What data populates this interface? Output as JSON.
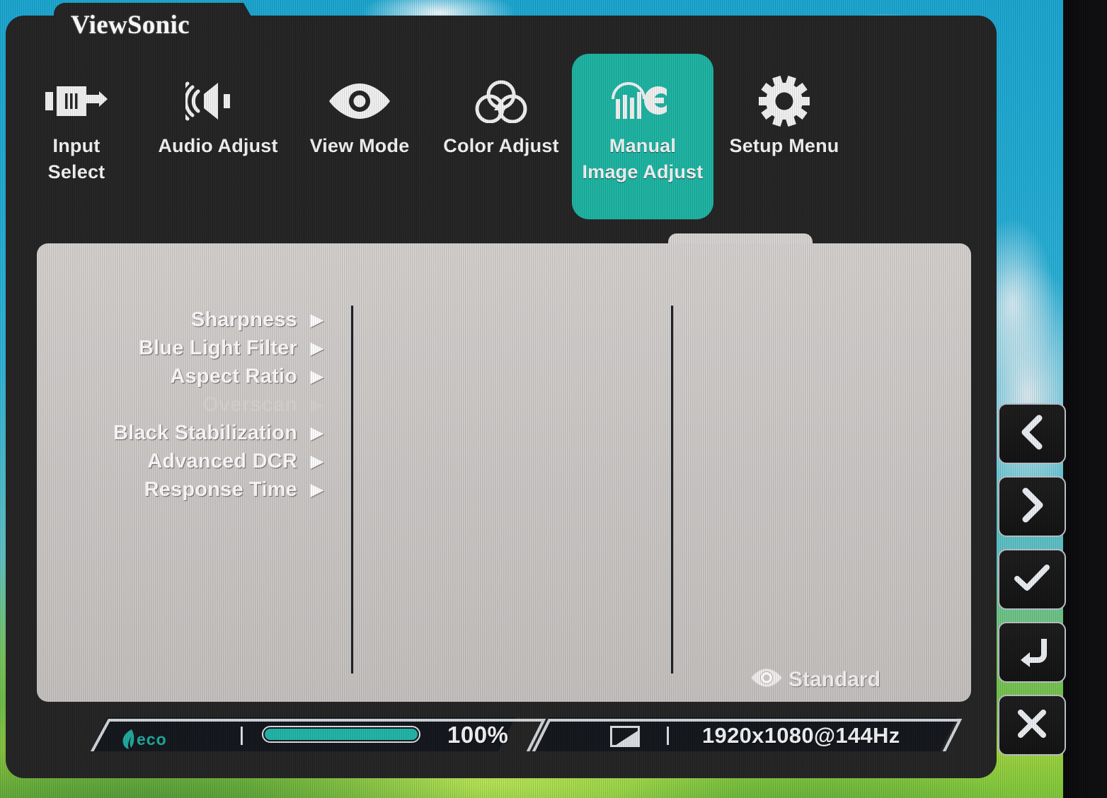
{
  "brand": {
    "logo_text": "ViewSonic"
  },
  "tabs": [
    {
      "id": "input-select",
      "label": "Input\nSelect",
      "icon": "input-connector-icon",
      "selected": false
    },
    {
      "id": "audio-adjust",
      "label": "Audio Adjust",
      "icon": "speaker-icon",
      "selected": false
    },
    {
      "id": "view-mode",
      "label": "View Mode",
      "icon": "eye-icon",
      "selected": false
    },
    {
      "id": "color-adjust",
      "label": "Color Adjust",
      "icon": "color-circles-icon",
      "selected": false
    },
    {
      "id": "manual-image-adjust",
      "label": "Manual\nImage Adjust",
      "icon": "sliders-wrench-icon",
      "selected": true
    },
    {
      "id": "setup-menu",
      "label": "Setup Menu",
      "icon": "gear-icon",
      "selected": false
    }
  ],
  "menu": {
    "items": [
      {
        "label": "Sharpness",
        "arrow": "▶",
        "disabled": false
      },
      {
        "label": "Blue Light Filter",
        "arrow": "▶",
        "disabled": false
      },
      {
        "label": "Aspect Ratio",
        "arrow": "▶",
        "disabled": false
      },
      {
        "label": "Overscan",
        "arrow": "▶",
        "disabled": true
      },
      {
        "label": "Black Stabilization",
        "arrow": "▶",
        "disabled": false
      },
      {
        "label": "Advanced DCR",
        "arrow": "▶",
        "disabled": false
      },
      {
        "label": "Response Time",
        "arrow": "▶",
        "disabled": false
      }
    ]
  },
  "viewmode_badge": {
    "icon": "eye-icon",
    "text": "Standard"
  },
  "statusbar": {
    "eco_label": "eco",
    "eco_icon": "eco-leaf-icon",
    "brightness_percent": "100%",
    "brightness_value": 100,
    "contrast_icon": "contrast-square-icon",
    "resolution": "1920x1080@144Hz"
  },
  "hardware_buttons": [
    {
      "id": "prev",
      "icon": "chevron-left-icon"
    },
    {
      "id": "next",
      "icon": "chevron-right-icon"
    },
    {
      "id": "confirm",
      "icon": "check-icon"
    },
    {
      "id": "back",
      "icon": "return-arrow-icon"
    },
    {
      "id": "exit",
      "icon": "close-x-icon"
    }
  ],
  "colors": {
    "accent_teal": "#1db2a1",
    "panel_gray": "#d6d2d0",
    "osd_dark": "#232323",
    "sky_blue": "#1ba5cf",
    "grass_green": "#7cc53a"
  }
}
